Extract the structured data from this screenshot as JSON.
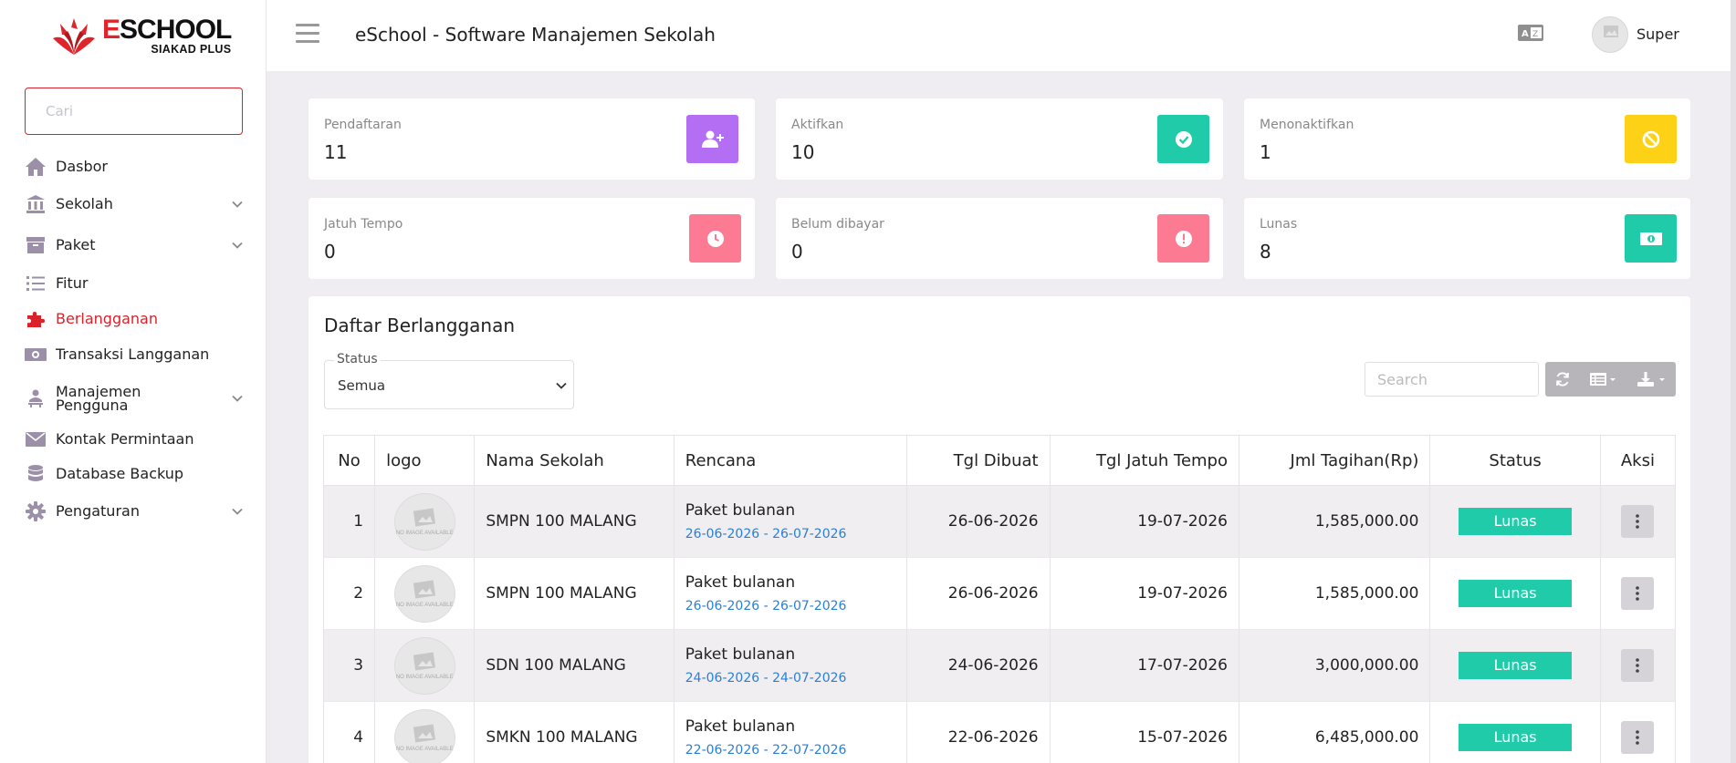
{
  "brand": {
    "title_e": "E",
    "title_rest": "SCHOOL",
    "subtitle": "SIAKAD PLUS"
  },
  "sidebar": {
    "search_placeholder": "Cari",
    "items": [
      {
        "label": "Dasbor",
        "icon": "home-icon"
      },
      {
        "label": "Sekolah",
        "icon": "institution-icon"
      },
      {
        "label": "Paket",
        "icon": "archive-icon"
      },
      {
        "label": "Fitur",
        "icon": "list-icon"
      },
      {
        "label": "Berlangganan",
        "icon": "puzzle-icon"
      },
      {
        "label": "Transaksi Langganan",
        "icon": "money-icon"
      },
      {
        "label": "Manajemen",
        "label2": "Pengguna",
        "icon": "users-icon"
      },
      {
        "label": "Kontak Permintaan",
        "icon": "envelope-icon"
      },
      {
        "label": "Database Backup",
        "icon": "database-icon"
      },
      {
        "label": "Pengaturan",
        "icon": "gear-icon"
      }
    ]
  },
  "header": {
    "app_title": "eSchool - Software Manajemen Sekolah",
    "user_name": "Super"
  },
  "stats": [
    {
      "label": "Pendaftaran",
      "value": "11",
      "color": "#b46ef4",
      "icon": "user-plus-icon"
    },
    {
      "label": "Aktifkan",
      "value": "10",
      "color": "#1fcba9",
      "icon": "check-circle-icon"
    },
    {
      "label": "Menonaktifkan",
      "value": "1",
      "color": "#fcd116",
      "icon": "ban-icon"
    },
    {
      "label": "Jatuh Tempo",
      "value": "0",
      "color": "#fc7b92",
      "icon": "clock-icon"
    },
    {
      "label": "Belum dibayar",
      "value": "0",
      "color": "#fc7b92",
      "icon": "exclamation-icon"
    },
    {
      "label": "Lunas",
      "value": "8",
      "color": "#1fcba9",
      "icon": "cash-icon"
    }
  ],
  "subscriptions": {
    "title": "Daftar Berlangganan",
    "status_label": "Status",
    "status_value": "Semua",
    "search_placeholder": "Search",
    "columns": [
      "No",
      "logo",
      "Nama Sekolah",
      "Rencana",
      "Tgl Dibuat",
      "Tgl Jatuh Tempo",
      "Jml Tagihan(Rp)",
      "Status",
      "Aksi"
    ],
    "no_image_text": "NO IMAGE AVAILABLE",
    "rows": [
      {
        "no": "1",
        "school": "SMPN 100 MALANG",
        "plan": "Paket bulanan",
        "range": "26-06-2026 - 26-07-2026",
        "created": "26-06-2026",
        "due": "19-07-2026",
        "amount": "1,585,000.00",
        "status": "Lunas"
      },
      {
        "no": "2",
        "school": "SMPN 100 MALANG",
        "plan": "Paket bulanan",
        "range": "26-06-2026 - 26-07-2026",
        "created": "26-06-2026",
        "due": "19-07-2026",
        "amount": "1,585,000.00",
        "status": "Lunas"
      },
      {
        "no": "3",
        "school": "SDN 100 MALANG",
        "plan": "Paket bulanan",
        "range": "24-06-2026 - 24-07-2026",
        "created": "24-06-2026",
        "due": "17-07-2026",
        "amount": "3,000,000.00",
        "status": "Lunas"
      },
      {
        "no": "4",
        "school": "SMKN 100 MALANG",
        "plan": "Paket bulanan",
        "range": "22-06-2026 - 22-07-2026",
        "created": "22-06-2026",
        "due": "15-07-2026",
        "amount": "6,485,000.00",
        "status": "Lunas"
      }
    ]
  }
}
